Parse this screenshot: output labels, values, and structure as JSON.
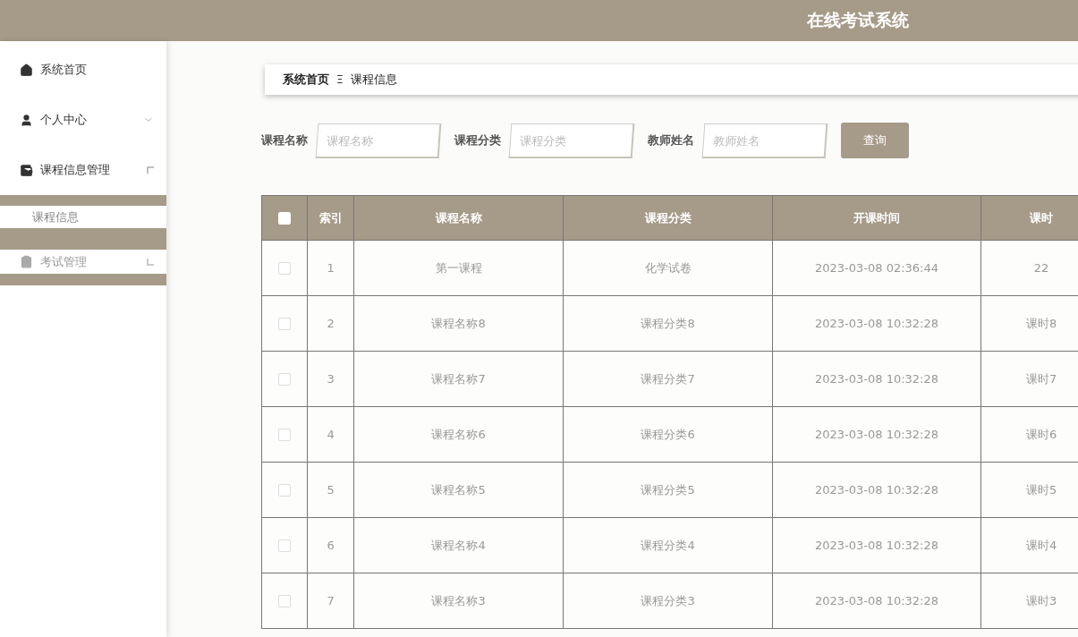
{
  "header": {
    "title": "在线考试系统"
  },
  "sidebar": {
    "items": [
      {
        "label": "系统首页",
        "muted": false
      },
      {
        "label": "个人中心",
        "expanded": false,
        "muted": false
      },
      {
        "label": "课程信息管理",
        "expanded": true,
        "muted": false,
        "children": [
          {
            "label": "课程信息",
            "selected": true
          }
        ]
      },
      {
        "label": "考试管理",
        "expanded": false,
        "muted": true
      }
    ]
  },
  "breadcrumb": {
    "home": "系统首页",
    "separator": "Ξ",
    "current": "课程信息"
  },
  "search": {
    "fields": [
      {
        "label": "课程名称",
        "placeholder": "课程名称"
      },
      {
        "label": "课程分类",
        "placeholder": "课程分类"
      },
      {
        "label": "教师姓名",
        "placeholder": "教师姓名"
      }
    ],
    "button": "查询"
  },
  "table": {
    "select_all": {
      "checked": false
    },
    "columns": [
      "索引",
      "课程名称",
      "课程分类",
      "开课时间",
      "课时"
    ],
    "rows": [
      {
        "checked": false,
        "cells": [
          "1",
          "第一课程",
          "化学试卷",
          "2023-03-08 02:36:44",
          "22"
        ]
      },
      {
        "checked": false,
        "cells": [
          "2",
          "课程名称8",
          "课程分类8",
          "2023-03-08 10:32:28",
          "课时8"
        ]
      },
      {
        "checked": false,
        "cells": [
          "3",
          "课程名称7",
          "课程分类7",
          "2023-03-08 10:32:28",
          "课时7"
        ]
      },
      {
        "checked": false,
        "cells": [
          "4",
          "课程名称6",
          "课程分类6",
          "2023-03-08 10:32:28",
          "课时6"
        ]
      },
      {
        "checked": false,
        "cells": [
          "5",
          "课程名称5",
          "课程分类5",
          "2023-03-08 10:32:28",
          "课时5"
        ]
      },
      {
        "checked": false,
        "cells": [
          "6",
          "课程名称4",
          "课程分类4",
          "2023-03-08 10:32:28",
          "课时4"
        ]
      },
      {
        "checked": false,
        "cells": [
          "7",
          "课程名称3",
          "课程分类3",
          "2023-03-08 10:32:28",
          "课时3"
        ]
      }
    ]
  }
}
